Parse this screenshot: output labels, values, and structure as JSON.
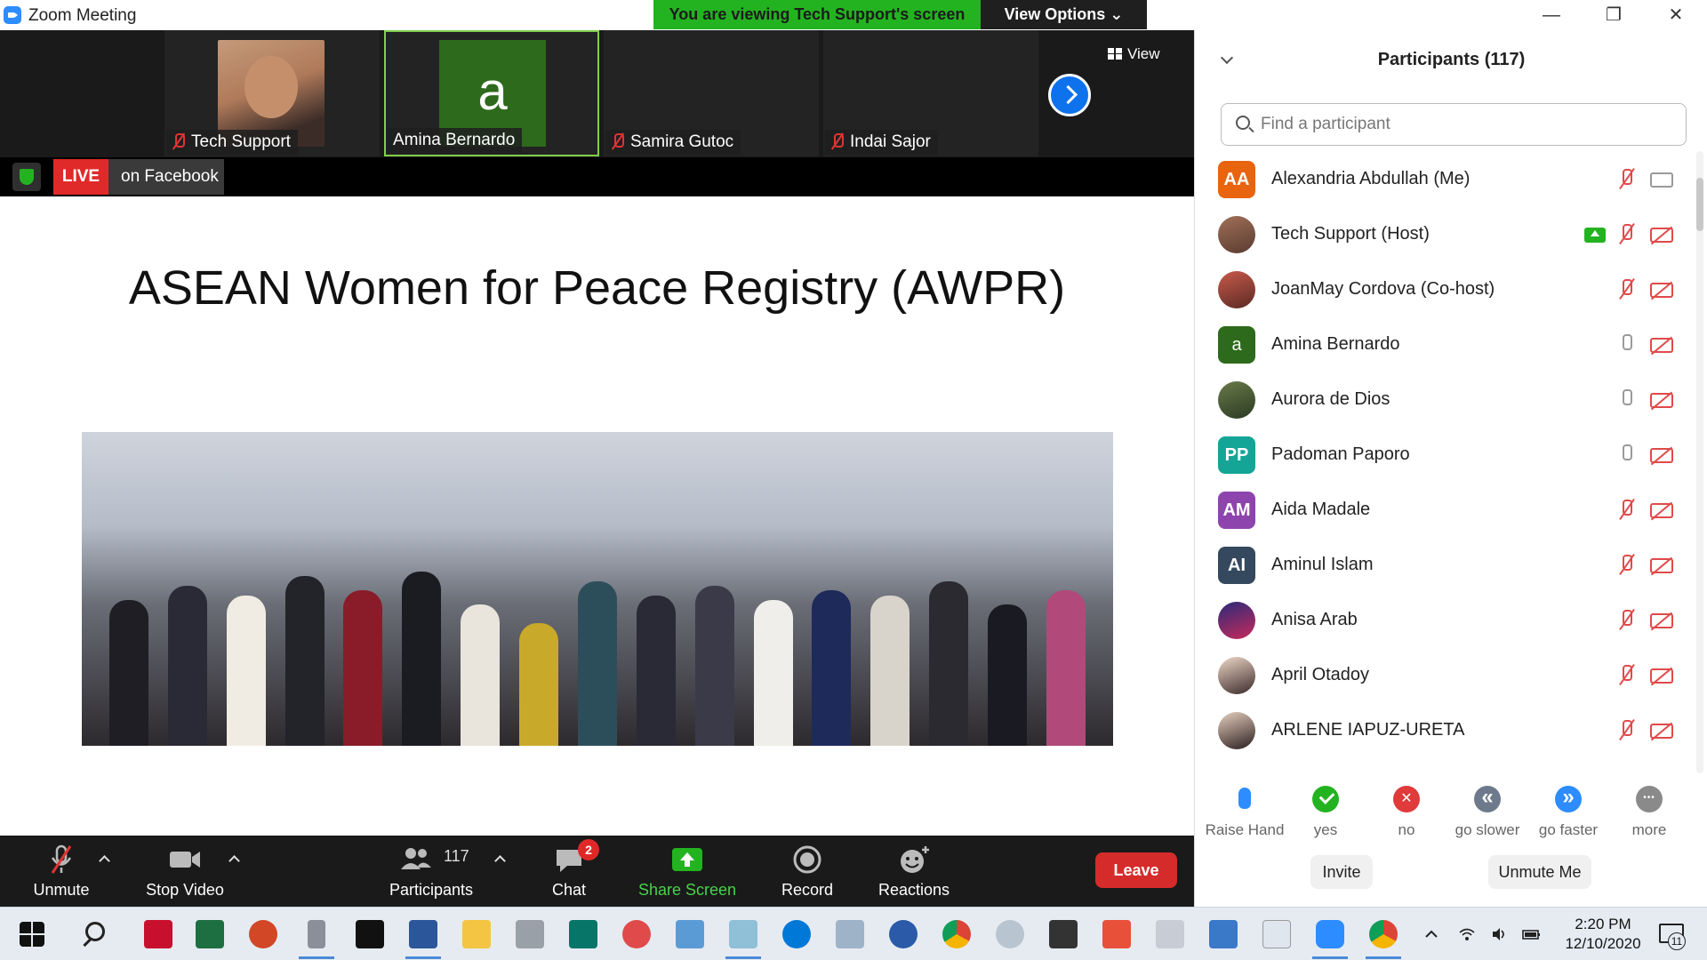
{
  "window": {
    "title": "Zoom Meeting",
    "minimize": "—",
    "maximize": "❐",
    "close": "✕"
  },
  "banner": {
    "viewing": "You are viewing Tech Support's screen",
    "view_options": "View Options ⌄"
  },
  "video_strip": {
    "tiles": [
      {
        "name": "Tech Support",
        "muted": true,
        "avatar": "photo"
      },
      {
        "name": "Amina Bernardo",
        "muted": false,
        "avatar": "a"
      },
      {
        "name": "Samira Gutoc",
        "muted": true
      },
      {
        "name": "Indai Sajor",
        "muted": true
      }
    ],
    "view_label": "View"
  },
  "live": {
    "badge": "LIVE",
    "platform": "on Facebook"
  },
  "slide": {
    "title": "ASEAN Women for Peace Registry (AWPR)"
  },
  "toolbar": {
    "unmute": "Unmute",
    "stop_video": "Stop Video",
    "participants_count": "117",
    "participants": "Participants",
    "chat": "Chat",
    "chat_badge": "2",
    "share_screen": "Share Screen",
    "record": "Record",
    "reactions": "Reactions",
    "leave": "Leave"
  },
  "panel": {
    "title": "Participants (117)",
    "search_placeholder": "Find a participant",
    "participants": [
      {
        "initials": "AA",
        "name": "Alexandria Abdullah (Me)",
        "color": "#e8640f",
        "mic": "off",
        "cam": "on"
      },
      {
        "initials": "",
        "name": "Tech Support (Host)",
        "color": "",
        "mic": "off",
        "cam": "off",
        "sharing": true
      },
      {
        "initials": "",
        "name": "JoanMay Cordova (Co-host)",
        "color": "",
        "mic": "off",
        "cam": "off"
      },
      {
        "initials": "a",
        "name": "Amina Bernardo",
        "color": "#2d6a1b",
        "mic": "on",
        "cam": "off"
      },
      {
        "initials": "",
        "name": "Aurora de Dios",
        "color": "",
        "mic": "on",
        "cam": "off"
      },
      {
        "initials": "PP",
        "name": "Padoman Paporo",
        "color": "#15a596",
        "mic": "on",
        "cam": "off"
      },
      {
        "initials": "AM",
        "name": "Aida Madale",
        "color": "#8e44ad",
        "mic": "off",
        "cam": "off"
      },
      {
        "initials": "AI",
        "name": "Aminul Islam",
        "color": "#34495e",
        "mic": "off",
        "cam": "off"
      },
      {
        "initials": "",
        "name": "Anisa Arab",
        "color": "",
        "mic": "off",
        "cam": "off"
      },
      {
        "initials": "",
        "name": "April Otadoy",
        "color": "",
        "mic": "off",
        "cam": "off"
      },
      {
        "initials": "",
        "name": "ARLENE IAPUZ-URETA",
        "color": "",
        "mic": "off",
        "cam": "off"
      }
    ],
    "feedback": {
      "raise_hand": "Raise Hand",
      "yes": "yes",
      "no": "no",
      "go_slower": "go slower",
      "go_faster": "go faster",
      "more": "more"
    },
    "invite": "Invite",
    "unmute_me": "Unmute Me"
  },
  "taskbar": {
    "apps": [
      "acrobat",
      "excel",
      "powerpoint",
      "mic",
      "media-player",
      "word",
      "file-explorer",
      "printer",
      "publisher",
      "todo",
      "control-panel",
      "notes",
      "edge",
      "photos-viewer",
      "app",
      "chrome",
      "disk",
      "store",
      "pdf",
      "doc",
      "photos",
      "library",
      "zoom",
      "chrome-profile"
    ],
    "time": "2:20 PM",
    "date": "12/10/2020",
    "notifications": "11"
  }
}
